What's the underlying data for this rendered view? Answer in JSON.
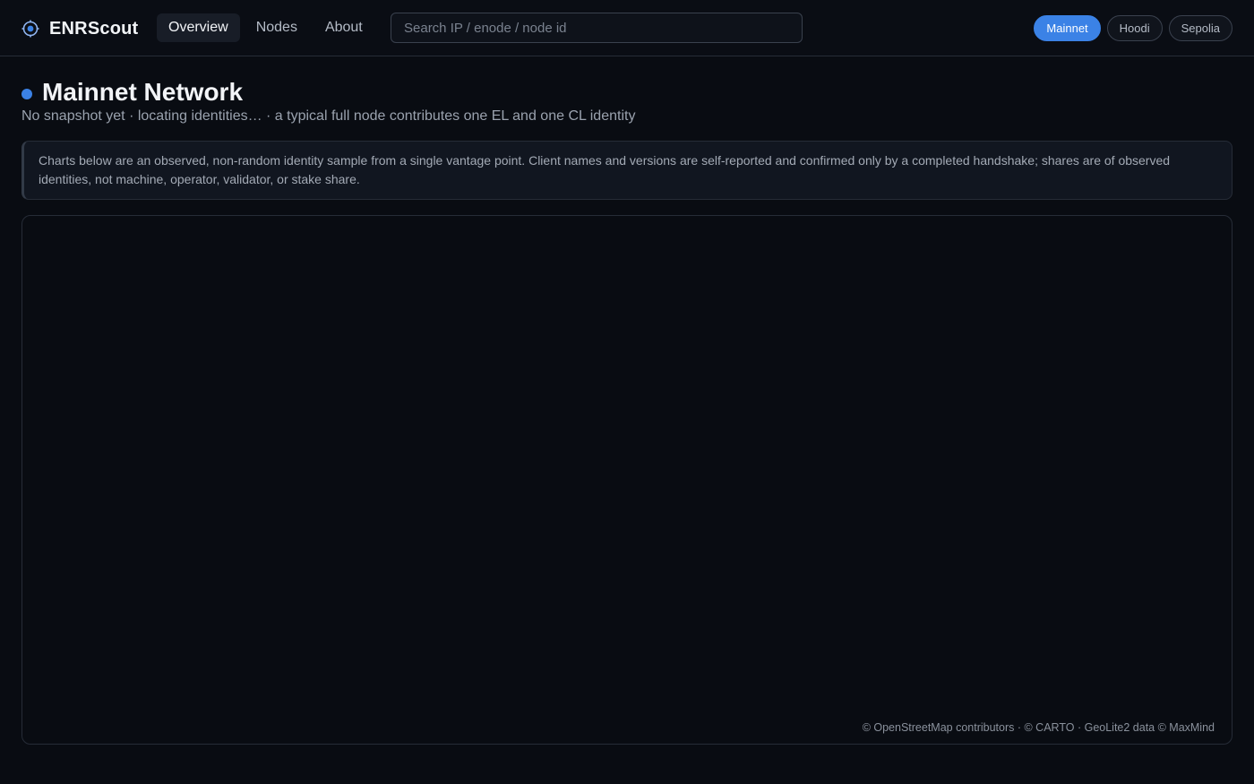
{
  "app": {
    "name": "ENRScout",
    "icon": "scout-logo-icon",
    "accent_color": "#3b82e6"
  },
  "nav": {
    "tabs": [
      {
        "label": "Overview",
        "active": true
      },
      {
        "label": "Nodes",
        "active": false
      },
      {
        "label": "About",
        "active": false
      }
    ]
  },
  "search": {
    "placeholder": "Search IP / enode / node id",
    "value": ""
  },
  "networks": [
    {
      "label": "Mainnet",
      "active": true
    },
    {
      "label": "Hoodi",
      "active": false
    },
    {
      "label": "Sepolia",
      "active": false
    }
  ],
  "header": {
    "title": "Mainnet Network",
    "subtitle": "No snapshot yet · locating identities… · a typical full node contributes one EL and one CL identity"
  },
  "notice": {
    "text": "Charts below are an observed, non-random identity sample from a single vantage point. Client names and versions are self-reported and confirmed only by a completed handshake; shares are of observed identities, not machine, operator, validator, or stake share."
  },
  "map": {
    "attribution": "© OpenStreetMap contributors · © CARTO · GeoLite2 data © MaxMind"
  }
}
